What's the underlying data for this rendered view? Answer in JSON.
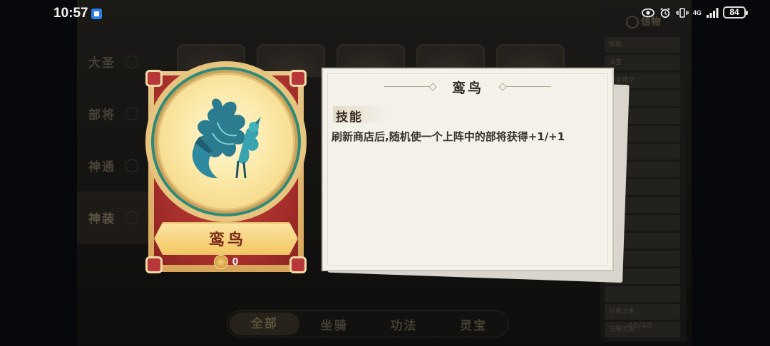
{
  "status_bar": {
    "time": "10:57",
    "network": "4G",
    "battery": "84"
  },
  "categories": [
    {
      "label": "大圣"
    },
    {
      "label": "部将"
    },
    {
      "label": "神通"
    },
    {
      "label": "神装"
    }
  ],
  "tabs": [
    {
      "label": "全部"
    },
    {
      "label": "坐骑"
    },
    {
      "label": "功法"
    },
    {
      "label": "灵宝"
    }
  ],
  "right_panel": {
    "title": "信物",
    "rows": [
      "瓶瓶",
      "法宝",
      "不金精华",
      "",
      "",
      "",
      "",
      "",
      "",
      "",
      "",
      "",
      "",
      "",
      "",
      "分身之术",
      "三眼灵石"
    ],
    "count": "48/48"
  },
  "item": {
    "name": "鸾鸟",
    "cost": "0"
  },
  "description": {
    "title": "鸾鸟",
    "section_label": "技能",
    "text": "刷新商店后,随机使一个上阵中的部将获得+1/+1"
  },
  "colors": {
    "accent_red": "#a52e2a",
    "gold": "#f3c765",
    "teal": "#2f8a78",
    "panel_bg": "#f4f1ea"
  }
}
